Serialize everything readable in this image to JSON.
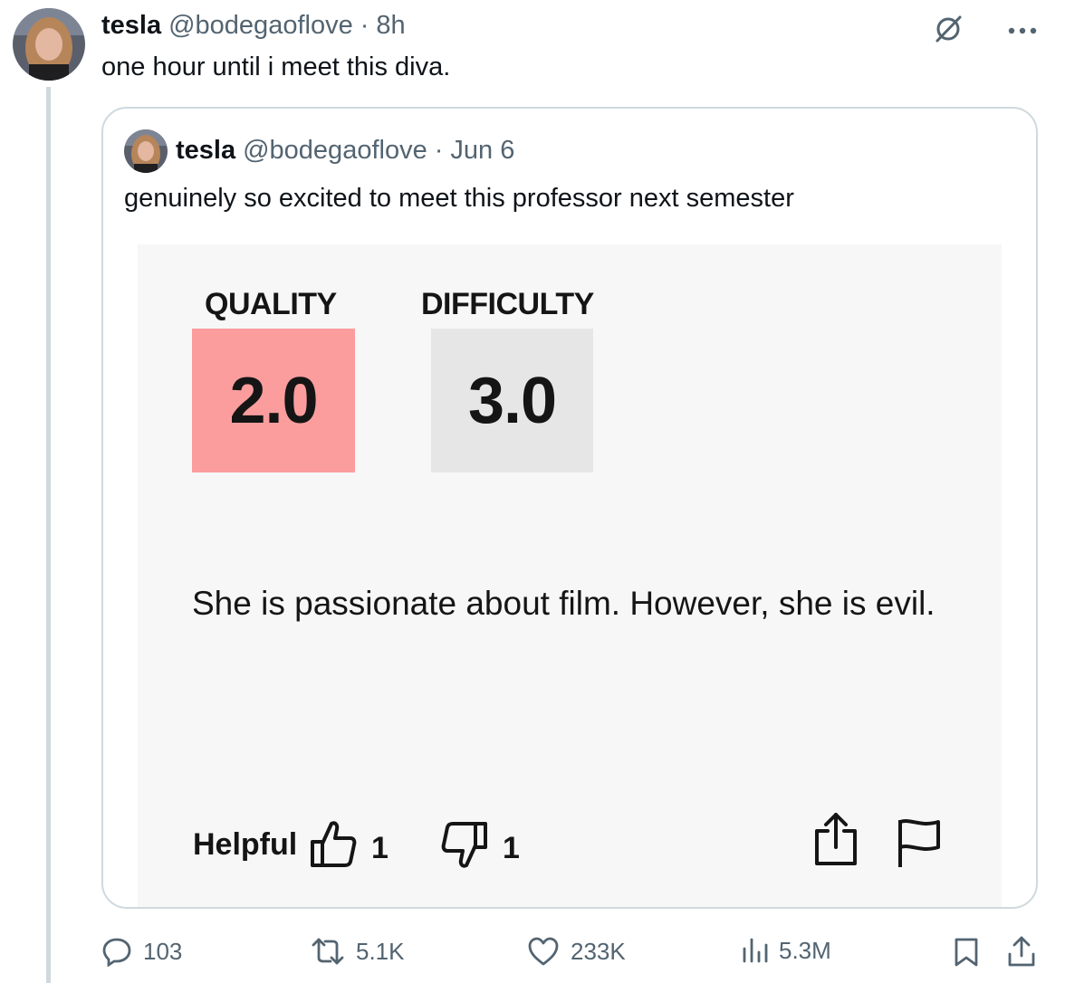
{
  "tweet": {
    "author_name": "tesla",
    "author_handle": "@bodegaoflove",
    "time": "· 8h",
    "text": "one hour until i meet this diva."
  },
  "quoted": {
    "author_name": "tesla",
    "author_handle": "@bodegaoflove",
    "time": "· Jun 6",
    "text": "genuinely so excited to meet this professor next semester",
    "image": {
      "quality": {
        "label": "QUALITY",
        "value": "2.0",
        "color": "#fc9d9d"
      },
      "difficulty": {
        "label": "DIFFICULTY",
        "value": "3.0",
        "color": "#e6e6e6"
      },
      "review": "She is passionate about film. However, she is evil.",
      "helpful_label": "Helpful",
      "thumbs_up_count": "1",
      "thumbs_down_count": "1"
    }
  },
  "actions": {
    "replies": "103",
    "reposts": "5.1K",
    "likes": "233K",
    "views": "5.3M"
  },
  "icons": {
    "grok": "grok-icon",
    "more": "more-icon",
    "reply": "reply-icon",
    "repost": "repost-icon",
    "like": "like-icon",
    "views": "views-icon",
    "bookmark": "bookmark-icon",
    "share": "share-icon"
  },
  "colors": {
    "text_primary": "#0f1419",
    "text_secondary": "#536471",
    "border": "#cfd9de"
  }
}
